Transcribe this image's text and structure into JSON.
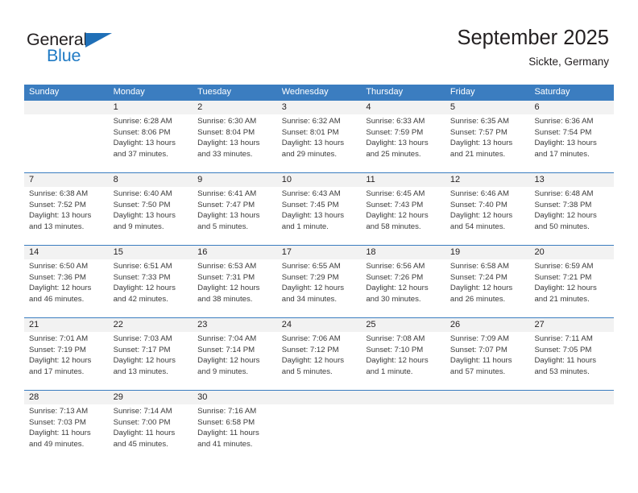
{
  "brand": {
    "name_top": "General",
    "name_bottom": "Blue",
    "triangle_color": "#1f6fb7",
    "blue_text_color": "#1f7ac4"
  },
  "header": {
    "title": "September 2025",
    "subtitle": "Sickte, Germany"
  },
  "theme": {
    "header_blue": "#3b7dc0",
    "date_strip_gray": "#f2f2f2",
    "text_color": "#231f20",
    "event_text_color": "#3b3b3b"
  },
  "weekday_headers": [
    "Sunday",
    "Monday",
    "Tuesday",
    "Wednesday",
    "Thursday",
    "Friday",
    "Saturday"
  ],
  "weeks": [
    {
      "days": [
        {
          "num": "",
          "sunrise": "",
          "sunset": "",
          "daylight_1": "",
          "daylight_2": ""
        },
        {
          "num": "1",
          "sunrise": "Sunrise: 6:28 AM",
          "sunset": "Sunset: 8:06 PM",
          "daylight_1": "Daylight: 13 hours",
          "daylight_2": "and 37 minutes."
        },
        {
          "num": "2",
          "sunrise": "Sunrise: 6:30 AM",
          "sunset": "Sunset: 8:04 PM",
          "daylight_1": "Daylight: 13 hours",
          "daylight_2": "and 33 minutes."
        },
        {
          "num": "3",
          "sunrise": "Sunrise: 6:32 AM",
          "sunset": "Sunset: 8:01 PM",
          "daylight_1": "Daylight: 13 hours",
          "daylight_2": "and 29 minutes."
        },
        {
          "num": "4",
          "sunrise": "Sunrise: 6:33 AM",
          "sunset": "Sunset: 7:59 PM",
          "daylight_1": "Daylight: 13 hours",
          "daylight_2": "and 25 minutes."
        },
        {
          "num": "5",
          "sunrise": "Sunrise: 6:35 AM",
          "sunset": "Sunset: 7:57 PM",
          "daylight_1": "Daylight: 13 hours",
          "daylight_2": "and 21 minutes."
        },
        {
          "num": "6",
          "sunrise": "Sunrise: 6:36 AM",
          "sunset": "Sunset: 7:54 PM",
          "daylight_1": "Daylight: 13 hours",
          "daylight_2": "and 17 minutes."
        }
      ]
    },
    {
      "days": [
        {
          "num": "7",
          "sunrise": "Sunrise: 6:38 AM",
          "sunset": "Sunset: 7:52 PM",
          "daylight_1": "Daylight: 13 hours",
          "daylight_2": "and 13 minutes."
        },
        {
          "num": "8",
          "sunrise": "Sunrise: 6:40 AM",
          "sunset": "Sunset: 7:50 PM",
          "daylight_1": "Daylight: 13 hours",
          "daylight_2": "and 9 minutes."
        },
        {
          "num": "9",
          "sunrise": "Sunrise: 6:41 AM",
          "sunset": "Sunset: 7:47 PM",
          "daylight_1": "Daylight: 13 hours",
          "daylight_2": "and 5 minutes."
        },
        {
          "num": "10",
          "sunrise": "Sunrise: 6:43 AM",
          "sunset": "Sunset: 7:45 PM",
          "daylight_1": "Daylight: 13 hours",
          "daylight_2": "and 1 minute."
        },
        {
          "num": "11",
          "sunrise": "Sunrise: 6:45 AM",
          "sunset": "Sunset: 7:43 PM",
          "daylight_1": "Daylight: 12 hours",
          "daylight_2": "and 58 minutes."
        },
        {
          "num": "12",
          "sunrise": "Sunrise: 6:46 AM",
          "sunset": "Sunset: 7:40 PM",
          "daylight_1": "Daylight: 12 hours",
          "daylight_2": "and 54 minutes."
        },
        {
          "num": "13",
          "sunrise": "Sunrise: 6:48 AM",
          "sunset": "Sunset: 7:38 PM",
          "daylight_1": "Daylight: 12 hours",
          "daylight_2": "and 50 minutes."
        }
      ]
    },
    {
      "days": [
        {
          "num": "14",
          "sunrise": "Sunrise: 6:50 AM",
          "sunset": "Sunset: 7:36 PM",
          "daylight_1": "Daylight: 12 hours",
          "daylight_2": "and 46 minutes."
        },
        {
          "num": "15",
          "sunrise": "Sunrise: 6:51 AM",
          "sunset": "Sunset: 7:33 PM",
          "daylight_1": "Daylight: 12 hours",
          "daylight_2": "and 42 minutes."
        },
        {
          "num": "16",
          "sunrise": "Sunrise: 6:53 AM",
          "sunset": "Sunset: 7:31 PM",
          "daylight_1": "Daylight: 12 hours",
          "daylight_2": "and 38 minutes."
        },
        {
          "num": "17",
          "sunrise": "Sunrise: 6:55 AM",
          "sunset": "Sunset: 7:29 PM",
          "daylight_1": "Daylight: 12 hours",
          "daylight_2": "and 34 minutes."
        },
        {
          "num": "18",
          "sunrise": "Sunrise: 6:56 AM",
          "sunset": "Sunset: 7:26 PM",
          "daylight_1": "Daylight: 12 hours",
          "daylight_2": "and 30 minutes."
        },
        {
          "num": "19",
          "sunrise": "Sunrise: 6:58 AM",
          "sunset": "Sunset: 7:24 PM",
          "daylight_1": "Daylight: 12 hours",
          "daylight_2": "and 26 minutes."
        },
        {
          "num": "20",
          "sunrise": "Sunrise: 6:59 AM",
          "sunset": "Sunset: 7:21 PM",
          "daylight_1": "Daylight: 12 hours",
          "daylight_2": "and 21 minutes."
        }
      ]
    },
    {
      "days": [
        {
          "num": "21",
          "sunrise": "Sunrise: 7:01 AM",
          "sunset": "Sunset: 7:19 PM",
          "daylight_1": "Daylight: 12 hours",
          "daylight_2": "and 17 minutes."
        },
        {
          "num": "22",
          "sunrise": "Sunrise: 7:03 AM",
          "sunset": "Sunset: 7:17 PM",
          "daylight_1": "Daylight: 12 hours",
          "daylight_2": "and 13 minutes."
        },
        {
          "num": "23",
          "sunrise": "Sunrise: 7:04 AM",
          "sunset": "Sunset: 7:14 PM",
          "daylight_1": "Daylight: 12 hours",
          "daylight_2": "and 9 minutes."
        },
        {
          "num": "24",
          "sunrise": "Sunrise: 7:06 AM",
          "sunset": "Sunset: 7:12 PM",
          "daylight_1": "Daylight: 12 hours",
          "daylight_2": "and 5 minutes."
        },
        {
          "num": "25",
          "sunrise": "Sunrise: 7:08 AM",
          "sunset": "Sunset: 7:10 PM",
          "daylight_1": "Daylight: 12 hours",
          "daylight_2": "and 1 minute."
        },
        {
          "num": "26",
          "sunrise": "Sunrise: 7:09 AM",
          "sunset": "Sunset: 7:07 PM",
          "daylight_1": "Daylight: 11 hours",
          "daylight_2": "and 57 minutes."
        },
        {
          "num": "27",
          "sunrise": "Sunrise: 7:11 AM",
          "sunset": "Sunset: 7:05 PM",
          "daylight_1": "Daylight: 11 hours",
          "daylight_2": "and 53 minutes."
        }
      ]
    },
    {
      "days": [
        {
          "num": "28",
          "sunrise": "Sunrise: 7:13 AM",
          "sunset": "Sunset: 7:03 PM",
          "daylight_1": "Daylight: 11 hours",
          "daylight_2": "and 49 minutes."
        },
        {
          "num": "29",
          "sunrise": "Sunrise: 7:14 AM",
          "sunset": "Sunset: 7:00 PM",
          "daylight_1": "Daylight: 11 hours",
          "daylight_2": "and 45 minutes."
        },
        {
          "num": "30",
          "sunrise": "Sunrise: 7:16 AM",
          "sunset": "Sunset: 6:58 PM",
          "daylight_1": "Daylight: 11 hours",
          "daylight_2": "and 41 minutes."
        },
        {
          "num": "",
          "sunrise": "",
          "sunset": "",
          "daylight_1": "",
          "daylight_2": ""
        },
        {
          "num": "",
          "sunrise": "",
          "sunset": "",
          "daylight_1": "",
          "daylight_2": ""
        },
        {
          "num": "",
          "sunrise": "",
          "sunset": "",
          "daylight_1": "",
          "daylight_2": ""
        },
        {
          "num": "",
          "sunrise": "",
          "sunset": "",
          "daylight_1": "",
          "daylight_2": ""
        }
      ]
    }
  ]
}
